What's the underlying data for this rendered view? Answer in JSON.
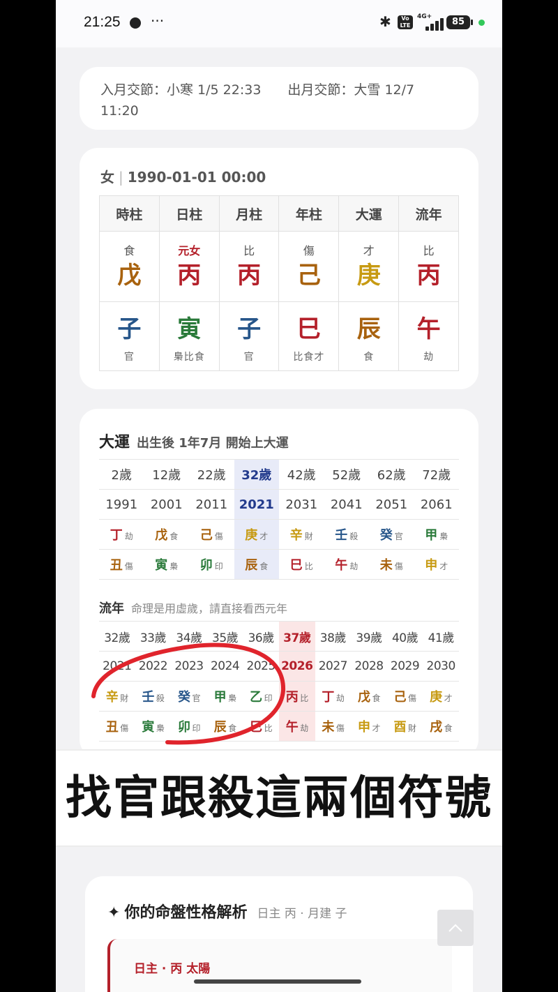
{
  "statusbar": {
    "time": "21:25",
    "dots": "···",
    "bluetooth_icon": "✱",
    "volte": "Vo LTE",
    "network": "4G+",
    "battery": "85"
  },
  "jieqi": {
    "in": "入月交節：小寒 1/5 22:33",
    "out": "出月交節：大雪 12/7 11:20"
  },
  "person": {
    "gender": "女",
    "separator": "|",
    "datetime": "1990-01-01 00:00"
  },
  "bazi": {
    "headers": [
      "時柱",
      "日柱",
      "月柱",
      "年柱",
      "大運",
      "流年"
    ],
    "columns": [
      {
        "god": "食",
        "stem": "戊",
        "stem_color": "#a8620e",
        "branch": "子",
        "branch_color": "#27568a",
        "hidden": "官"
      },
      {
        "god": "元女",
        "god_color": "#b4202a",
        "stem": "丙",
        "stem_color": "#b4202a",
        "branch": "寅",
        "branch_color": "#2a7a3a",
        "hidden": "梟比食"
      },
      {
        "god": "比",
        "stem": "丙",
        "stem_color": "#b4202a",
        "branch": "子",
        "branch_color": "#27568a",
        "hidden": "官"
      },
      {
        "god": "傷",
        "stem": "己",
        "stem_color": "#a8620e",
        "branch": "巳",
        "branch_color": "#b4202a",
        "hidden": "比食才"
      },
      {
        "god": "才",
        "stem": "庚",
        "stem_color": "#c79a12",
        "branch": "辰",
        "branch_color": "#a8620e",
        "hidden": "食"
      },
      {
        "god": "比",
        "stem": "丙",
        "stem_color": "#b4202a",
        "branch": "午",
        "branch_color": "#b4202a",
        "hidden": "劫"
      }
    ]
  },
  "dayun": {
    "title": "大運",
    "subtitle": "出生後 1年7月 開始上大運",
    "ages": [
      "2歲",
      "12歲",
      "22歲",
      "32歲",
      "42歲",
      "52歲",
      "62歲",
      "72歲"
    ],
    "years": [
      "1991",
      "2001",
      "2011",
      "2021",
      "2031",
      "2041",
      "2051",
      "2061"
    ],
    "stems": [
      {
        "c": "丁",
        "g": "劫",
        "color": "#b4202a"
      },
      {
        "c": "戊",
        "g": "食",
        "color": "#a8620e"
      },
      {
        "c": "己",
        "g": "傷",
        "color": "#a8620e"
      },
      {
        "c": "庚",
        "g": "才",
        "color": "#c79a12"
      },
      {
        "c": "辛",
        "g": "財",
        "color": "#c79a12"
      },
      {
        "c": "壬",
        "g": "殺",
        "color": "#27568a"
      },
      {
        "c": "癸",
        "g": "官",
        "color": "#27568a"
      },
      {
        "c": "甲",
        "g": "梟",
        "color": "#2a7a3a"
      }
    ],
    "branches": [
      {
        "c": "丑",
        "g": "傷",
        "color": "#a8620e"
      },
      {
        "c": "寅",
        "g": "梟",
        "color": "#2a7a3a"
      },
      {
        "c": "卯",
        "g": "印",
        "color": "#2a7a3a"
      },
      {
        "c": "辰",
        "g": "食",
        "color": "#a8620e"
      },
      {
        "c": "巳",
        "g": "比",
        "color": "#b4202a"
      },
      {
        "c": "午",
        "g": "劫",
        "color": "#b4202a"
      },
      {
        "c": "未",
        "g": "傷",
        "color": "#a8620e"
      },
      {
        "c": "申",
        "g": "才",
        "color": "#c79a12"
      }
    ],
    "highlight_index": 3,
    "highlight_color": "#e8ebf8"
  },
  "liunian": {
    "title": "流年",
    "note": "命理是用虛歲，請直接看西元年",
    "ages": [
      "32歲",
      "33歲",
      "34歲",
      "35歲",
      "36歲",
      "37歲",
      "38歲",
      "39歲",
      "40歲",
      "41歲"
    ],
    "years": [
      "2021",
      "2022",
      "2023",
      "2024",
      "2025",
      "2026",
      "2027",
      "2028",
      "2029",
      "2030"
    ],
    "stems": [
      {
        "c": "辛",
        "g": "財",
        "color": "#c79a12"
      },
      {
        "c": "壬",
        "g": "殺",
        "color": "#27568a"
      },
      {
        "c": "癸",
        "g": "官",
        "color": "#27568a"
      },
      {
        "c": "甲",
        "g": "梟",
        "color": "#2a7a3a"
      },
      {
        "c": "乙",
        "g": "印",
        "color": "#2a7a3a"
      },
      {
        "c": "丙",
        "g": "比",
        "color": "#b4202a"
      },
      {
        "c": "丁",
        "g": "劫",
        "color": "#b4202a"
      },
      {
        "c": "戊",
        "g": "食",
        "color": "#a8620e"
      },
      {
        "c": "己",
        "g": "傷",
        "color": "#a8620e"
      },
      {
        "c": "庚",
        "g": "才",
        "color": "#c79a12"
      }
    ],
    "branches": [
      {
        "c": "丑",
        "g": "傷",
        "color": "#a8620e"
      },
      {
        "c": "寅",
        "g": "梟",
        "color": "#2a7a3a"
      },
      {
        "c": "卯",
        "g": "印",
        "color": "#2a7a3a"
      },
      {
        "c": "辰",
        "g": "食",
        "color": "#a8620e"
      },
      {
        "c": "巳",
        "g": "比",
        "color": "#b4202a"
      },
      {
        "c": "午",
        "g": "劫",
        "color": "#b4202a"
      },
      {
        "c": "未",
        "g": "傷",
        "color": "#a8620e"
      },
      {
        "c": "申",
        "g": "才",
        "color": "#c79a12"
      },
      {
        "c": "酉",
        "g": "財",
        "color": "#c79a12"
      },
      {
        "c": "戌",
        "g": "食",
        "color": "#a8620e"
      }
    ],
    "highlight_index": 5,
    "highlight_color": "#fbe6e6"
  },
  "annotation": {
    "circle_color": "#e0242c"
  },
  "caption": "找官跟殺這兩個符號",
  "analysis": {
    "star_icon": "✦",
    "title": "你的命盤性格解析",
    "subtitle": "日主 丙 · 月建 子",
    "label": "日主 · 丙 太陽"
  },
  "scroll_top_icon": "chevron-up-icon"
}
